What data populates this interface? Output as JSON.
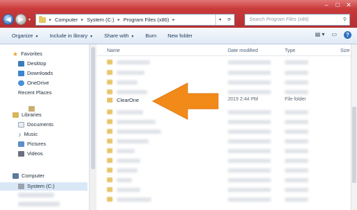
{
  "address": {
    "segments": [
      "Computer",
      "System (C:)",
      "Program Files (x86)"
    ]
  },
  "search": {
    "placeholder": "Search Program Files (x86)"
  },
  "toolbar": {
    "organize": "Organize",
    "include_in_library": "Include in library",
    "share_with": "Share with",
    "burn": "Burn",
    "new_folder": "New folder"
  },
  "nav": {
    "favorites": "Favorites",
    "desktop": "Desktop",
    "downloads": "Downloads",
    "onedrive": "OneDrive",
    "recent_places": "Recent Places",
    "libraries": "Libraries",
    "documents": "Documents",
    "music": "Music",
    "pictures": "Pictures",
    "videos": "Videos",
    "computer": "Computer",
    "system_c": "System (C:)"
  },
  "columns": {
    "name": "Name",
    "date_modified": "Date modified",
    "type": "Type",
    "size": "Size"
  },
  "highlighted_row": {
    "name": "ClearOne",
    "date_modified": "2015 2:44 PM",
    "type": "File folder"
  },
  "colors": {
    "title_bar": "#c93a3a",
    "arrow": "#f28a1a",
    "command_bar": "#dfe9f5"
  }
}
